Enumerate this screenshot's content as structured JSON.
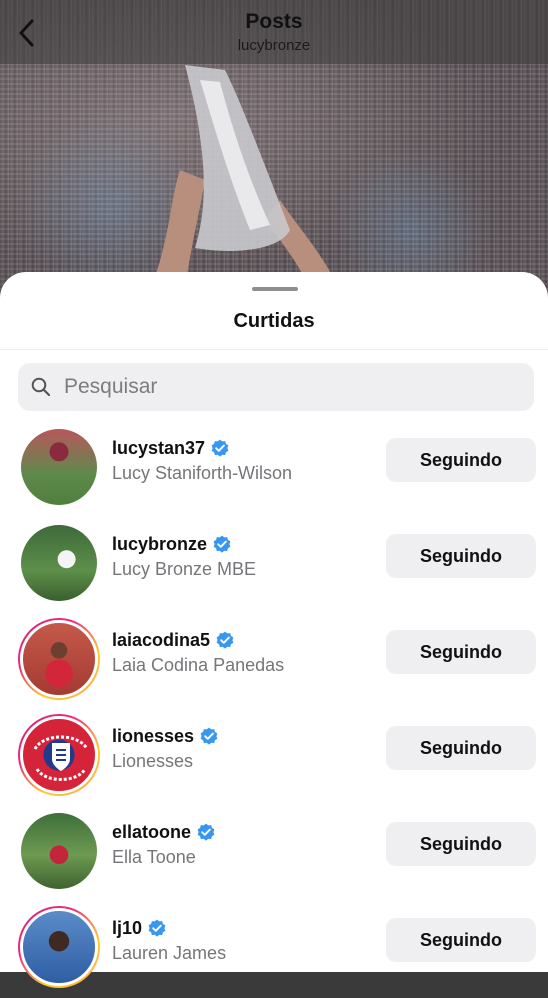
{
  "header": {
    "title": "Posts",
    "subtitle": "lucybronze"
  },
  "sheet": {
    "title": "Curtidas",
    "search_placeholder": "Pesquisar"
  },
  "likes": [
    {
      "username": "lucystan37",
      "full_name": "Lucy Staniforth-Wilson",
      "verified": true,
      "story_ring": false,
      "button_label": "Seguindo"
    },
    {
      "username": "lucybronze",
      "full_name": "Lucy Bronze MBE",
      "verified": true,
      "story_ring": false,
      "button_label": "Seguindo"
    },
    {
      "username": "laiacodina5",
      "full_name": "Laia Codina Panedas",
      "verified": true,
      "story_ring": true,
      "button_label": "Seguindo"
    },
    {
      "username": "lionesses",
      "full_name": "Lionesses",
      "verified": true,
      "story_ring": true,
      "button_label": "Seguindo"
    },
    {
      "username": "ellatoone",
      "full_name": "Ella Toone",
      "verified": true,
      "story_ring": false,
      "button_label": "Seguindo"
    },
    {
      "username": "lj10",
      "full_name": "Lauren James",
      "verified": true,
      "story_ring": true,
      "button_label": "Seguindo"
    }
  ],
  "colors": {
    "verified_blue": "#3897f0",
    "button_bg": "#efeff1",
    "secondary_text": "#76767a"
  }
}
